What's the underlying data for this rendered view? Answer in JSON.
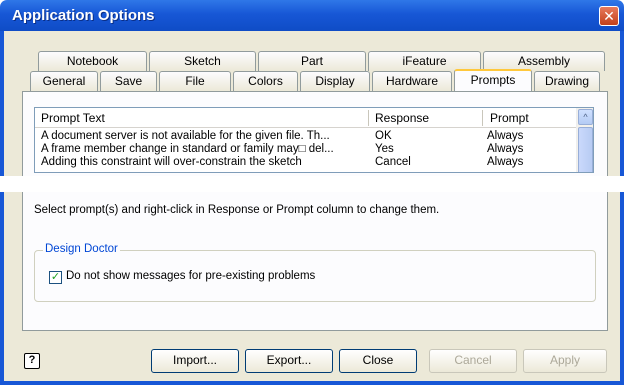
{
  "window": {
    "title": "Application Options",
    "close_glyph": "✕"
  },
  "tabs_row1": [
    "Notebook",
    "Sketch",
    "Part",
    "iFeature",
    "Assembly"
  ],
  "tabs_row2": [
    "General",
    "Save",
    "File",
    "Colors",
    "Display",
    "Hardware",
    "Prompts",
    "Drawing"
  ],
  "active_tab": "Prompts",
  "list": {
    "headers": [
      "Prompt Text",
      "Response",
      "Prompt"
    ],
    "rows": [
      [
        "A document server is not available for the given file.  Th...",
        "OK",
        "Always"
      ],
      [
        "A frame member change in standard or family may□ del...",
        "Yes",
        "Always"
      ],
      [
        "Adding this constraint will over-constrain the sketch",
        "Cancel",
        "Always"
      ]
    ],
    "scroll_up_glyph": "^"
  },
  "hint": "Select prompt(s) and right-click in Response or Prompt column to change them.",
  "design_doctor": {
    "label": "Design Doctor",
    "checkbox_label": "Do not show messages for pre-existing problems",
    "checked": true,
    "check_glyph": "✓"
  },
  "buttons": {
    "help": "?",
    "import": "Import...",
    "export": "Export...",
    "close": "Close",
    "cancel": "Cancel",
    "apply": "Apply"
  },
  "colors": {
    "title_bar": "#1757d6",
    "active_tab_accent": "#ffc83c",
    "group_label": "#0046d5"
  }
}
